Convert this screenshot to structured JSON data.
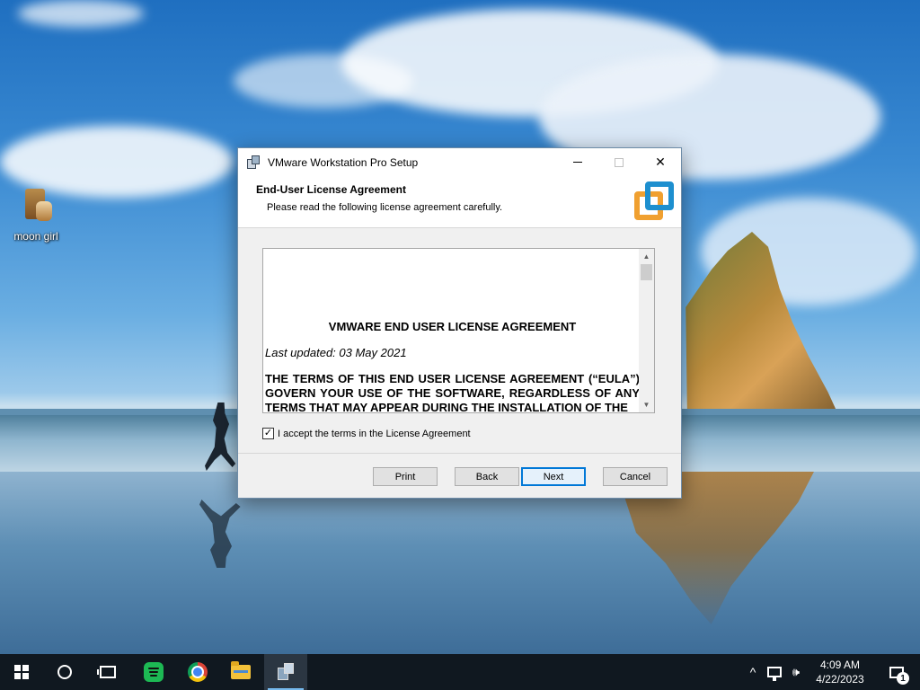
{
  "desktop": {
    "icons": [
      {
        "label": "moon girl"
      }
    ]
  },
  "window": {
    "title": "VMware Workstation Pro Setup",
    "controls": {
      "minimize": "minimize",
      "maximize": "maximize",
      "close": "✕"
    },
    "header": {
      "title": "End-User License Agreement",
      "subtitle": "Please read the following license agreement carefully."
    },
    "eula": {
      "heading": "VMWARE END USER LICENSE AGREEMENT",
      "updated": "Last updated: 03 May 2021",
      "terms": "THE TERMS OF THIS END USER LICENSE AGREEMENT (“EULA”) GOVERN YOUR USE OF THE SOFTWARE, REGARDLESS OF ANY TERMS THAT MAY APPEAR DURING THE INSTALLATION OF THE"
    },
    "accept": {
      "label": "I accept the terms in the License Agreement",
      "checked": true
    },
    "buttons": {
      "print": "Print",
      "back": "Back",
      "next": "Next",
      "cancel": "Cancel"
    }
  },
  "taskbar": {
    "items": [
      "start-icon",
      "search-icon",
      "task-view-icon",
      "green-app-icon",
      "chrome-icon",
      "file-explorer-icon",
      "vmware-setup-icon"
    ],
    "tray": {
      "chevron": "^",
      "volume": "🕪"
    },
    "clock": {
      "time": "4:09 AM",
      "date": "4/22/2023"
    },
    "notifications": {
      "count": "1"
    }
  },
  "colors": {
    "accent": "#0078d7",
    "vmware_orange": "#f0a030",
    "vmware_blue": "#1d8fcf",
    "taskbar": "#101820"
  }
}
